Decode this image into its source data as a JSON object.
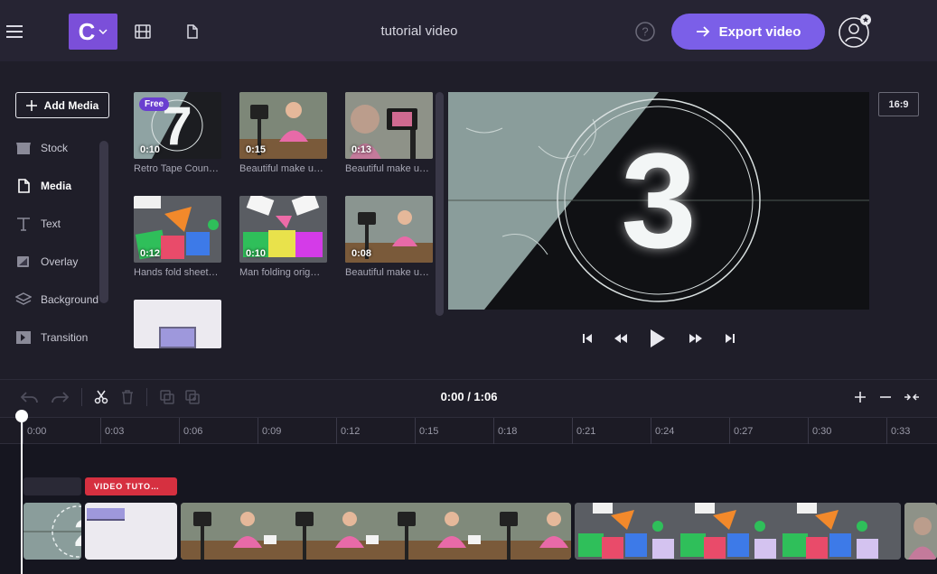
{
  "header": {
    "title": "tutorial video",
    "brand_letter": "C",
    "export_label": "Export video"
  },
  "sidebar": {
    "add_media": "Add Media",
    "items": [
      {
        "label": "Stock"
      },
      {
        "label": "Media"
      },
      {
        "label": "Text"
      },
      {
        "label": "Overlay"
      },
      {
        "label": "Background"
      },
      {
        "label": "Transition"
      }
    ]
  },
  "media": {
    "items": [
      {
        "duration": "0:10",
        "caption": "Retro Tape Coun…",
        "badge": "Free"
      },
      {
        "duration": "0:15",
        "caption": "Beautiful make u…"
      },
      {
        "duration": "0:13",
        "caption": "Beautiful make u…"
      },
      {
        "duration": "0:12",
        "caption": "Hands fold sheet…"
      },
      {
        "duration": "0:10",
        "caption": "Man folding orig…"
      },
      {
        "duration": "0:08",
        "caption": "Beautiful make u…"
      }
    ]
  },
  "preview": {
    "frame_number": "3",
    "aspect_ratio": "16:9"
  },
  "timeline": {
    "time_display": "0:00 / 1:06",
    "ticks": [
      "0:00",
      "0:03",
      "0:06",
      "0:09",
      "0:12",
      "0:15",
      "0:18",
      "0:21",
      "0:24",
      "0:27",
      "0:30",
      "0:33"
    ],
    "text_clip_label": "VIDEO TUTO…"
  },
  "colors": {
    "accent": "#7b5fe8",
    "brand": "#7b4fd9",
    "text_clip": "#d63040"
  }
}
